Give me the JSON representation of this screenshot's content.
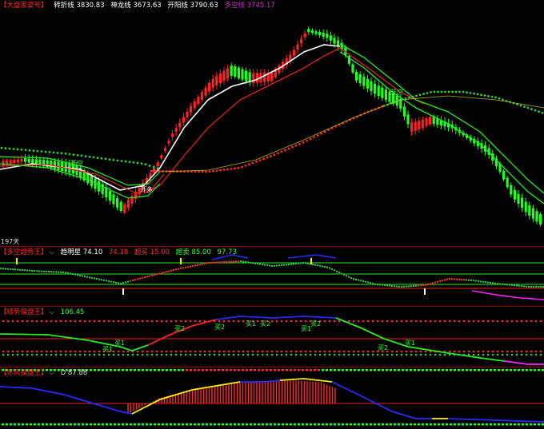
{
  "main": {
    "title": "【大盘家宴号】",
    "items": [
      {
        "label": "转折线",
        "value": "3830.83",
        "color": "#ffffff"
      },
      {
        "label": "神龙线",
        "value": "3673.63",
        "color": "#ffffff"
      },
      {
        "label": "开阳线",
        "value": "3790.63",
        "color": "#ffffff"
      },
      {
        "label": "多空线",
        "value": "3745.17",
        "color": "#cc33cc"
      }
    ],
    "bottom_label": "197天",
    "annotations": [
      "开空",
      "开多",
      "开空"
    ]
  },
  "pane2": {
    "title": "【多空趋势王】",
    "items": [
      {
        "label": "趋明星",
        "value": "74.10",
        "color": "#ffffff"
      },
      {
        "label": "",
        "value": "74.18",
        "color": "#ff3333"
      },
      {
        "label": "超买",
        "value": "15.00",
        "color": "#ff3333"
      },
      {
        "label": "超卖",
        "value": "85.00",
        "color": "#33ff33"
      },
      {
        "label": "",
        "value": "97.73",
        "color": "#33ff33"
      }
    ]
  },
  "pane3": {
    "title": "【顺势操盘王】",
    "value": "106.45",
    "labels": [
      "买1",
      "买1",
      "买2",
      "买2",
      "买1",
      "买2",
      "买1",
      "买2",
      "买2",
      "买1"
    ]
  },
  "pane4": {
    "title": "【东风操盘王】",
    "value_label": "D",
    "value": "87.88"
  },
  "colors": {
    "up": "#ff2020",
    "down": "#20ff20",
    "white_line": "#ffffff",
    "red_line": "#e02020",
    "green_line": "#22ee22",
    "dotted_ma": "#2ecc40",
    "dotted_red": "#ff2a2a",
    "magenta": "#ff22ff",
    "blue": "#2a2aff",
    "yellow": "#ffee00"
  }
}
